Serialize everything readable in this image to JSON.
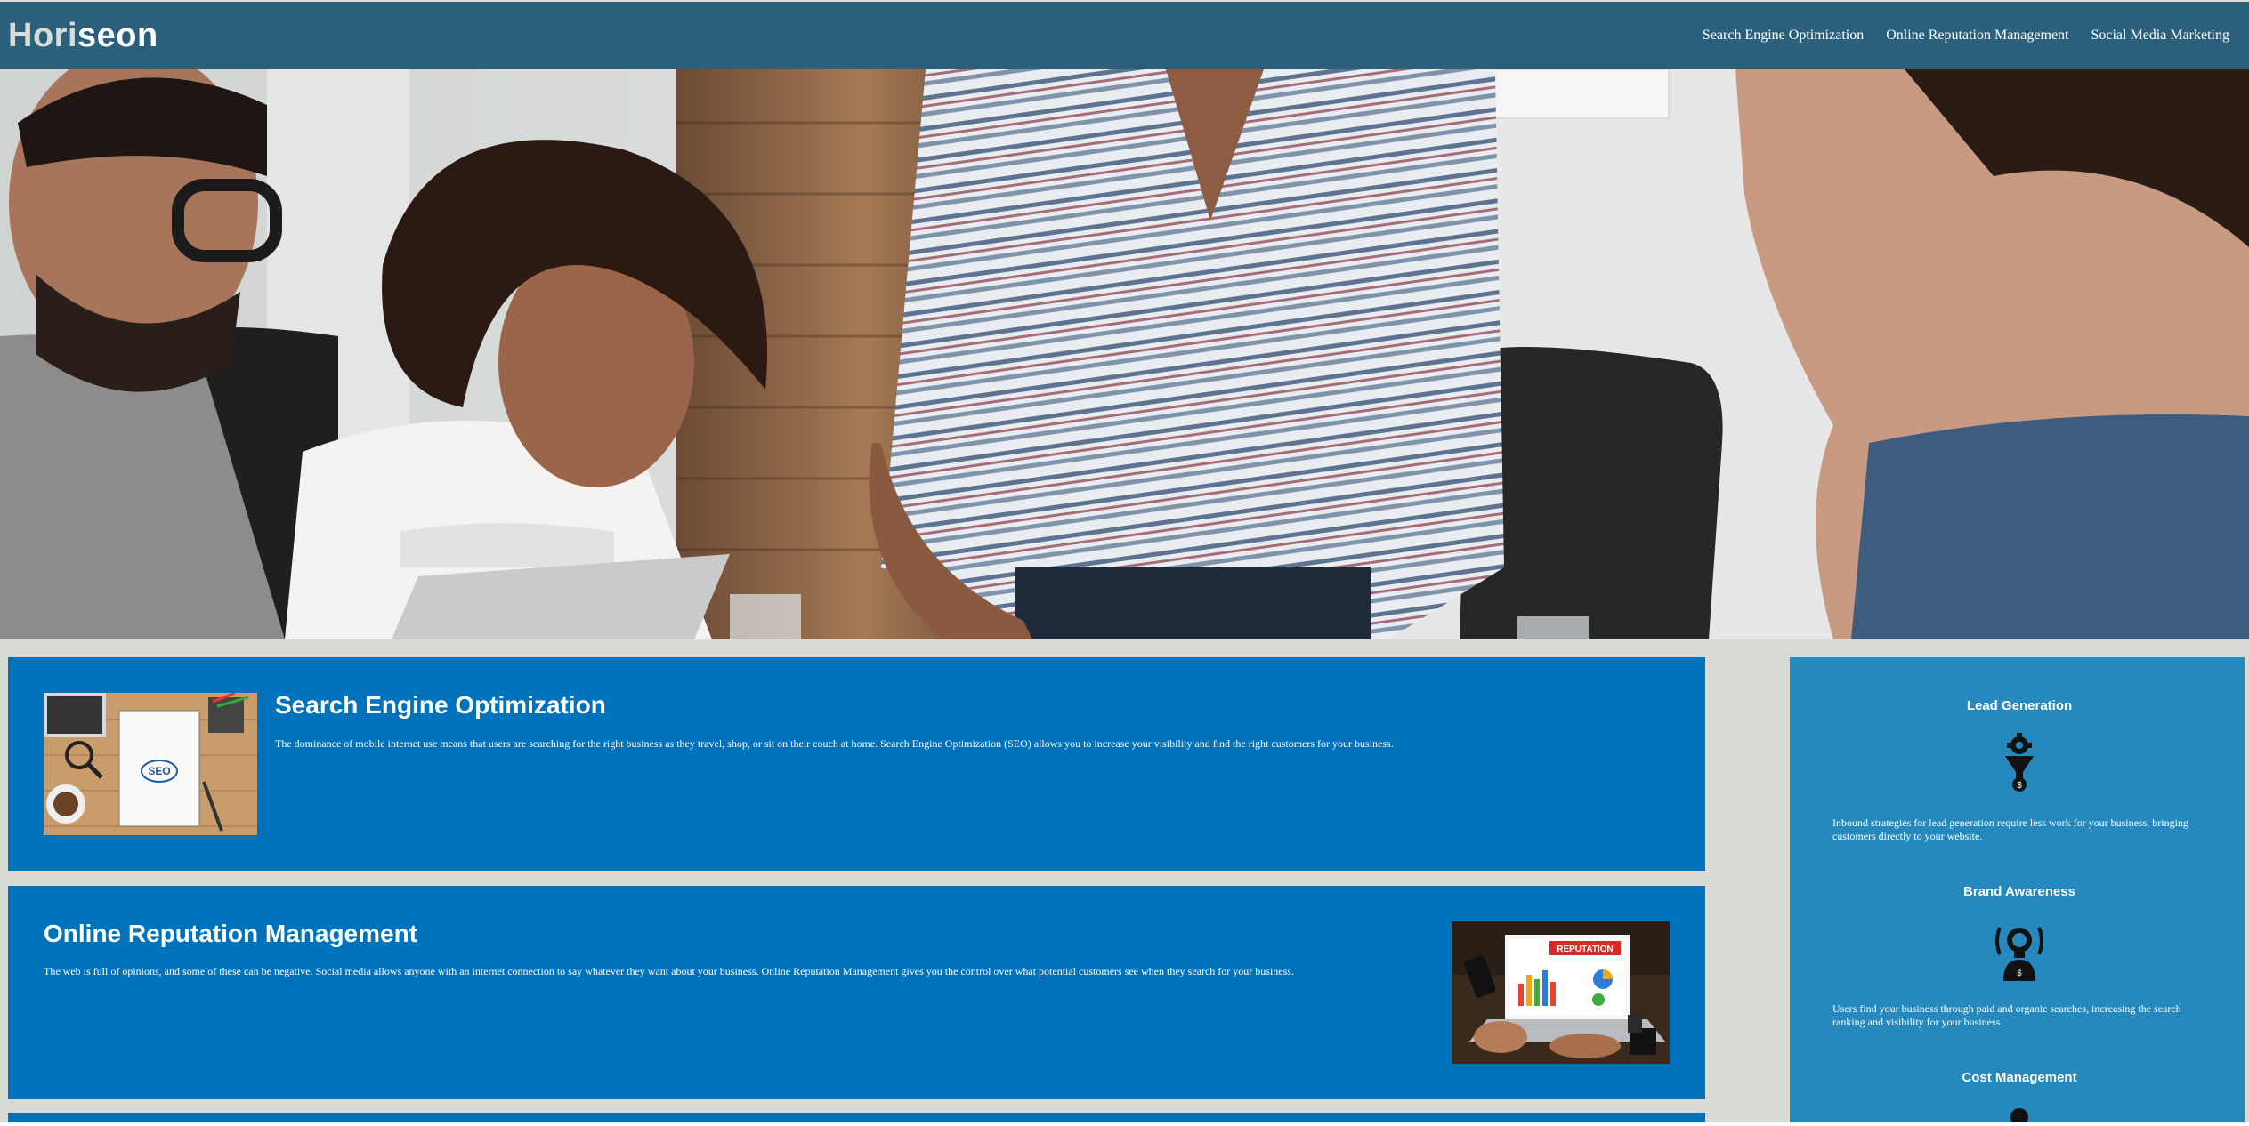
{
  "header": {
    "logo_primary": "Hori",
    "logo_accent": "seon",
    "nav": [
      "Search Engine Optimization",
      "Online Reputation Management",
      "Social Media Marketing"
    ]
  },
  "content": {
    "seo": {
      "title": "Search Engine Optimization",
      "text": "The dominance of mobile internet use means that users are searching for the right business as they travel, shop, or sit on their couch at home. Search Engine Optimization (SEO) allows you to increase your visibility and find the right customers for your business."
    },
    "orm": {
      "title": "Online Reputation Management",
      "text": "The web is full of opinions, and some of these can be negative. Social media allows anyone with an internet connection to say whatever they want about your business. Online Reputation Management gives you the control over what potential customers see when they search for your business.",
      "image_label": "REPUTATION"
    }
  },
  "benefits": [
    {
      "title": "Lead Generation",
      "icon": "funnel-gear-icon",
      "text": "Inbound strategies for lead generation require less work for your business, bringing customers directly to your website."
    },
    {
      "title": "Brand Awareness",
      "icon": "lightbulb-person-icon",
      "text": "Users find your business through paid and organic searches, increasing the search ranking and visibility for your business."
    },
    {
      "title": "Cost Management",
      "icon": "cost-icon",
      "text": ""
    }
  ],
  "colors": {
    "header": "#2a607c",
    "content_card": "#0072bb",
    "benefits_panel": "#2589bd",
    "page_bg": "#d9dcd6"
  }
}
